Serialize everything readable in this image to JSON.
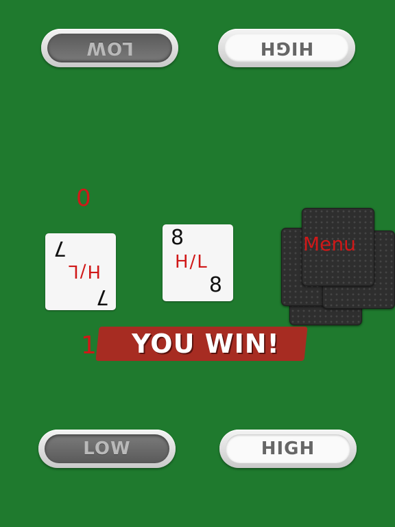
{
  "top_controls": {
    "low_label": "LOW",
    "high_label": "HIGH"
  },
  "bottom_controls": {
    "low_label": "LOW",
    "high_label": "HIGH"
  },
  "opponent_score": "0",
  "player_score": "1",
  "left_card": {
    "rank": "7",
    "center_text": "H/L"
  },
  "center_card": {
    "rank": "8",
    "center_text": "H/L"
  },
  "deck": {
    "menu_label": "Menu"
  },
  "result_banner": "YOU WIN!",
  "colors": {
    "table": "#1f7a2e",
    "accent_red": "#d01818",
    "banner": "#a72c22"
  }
}
